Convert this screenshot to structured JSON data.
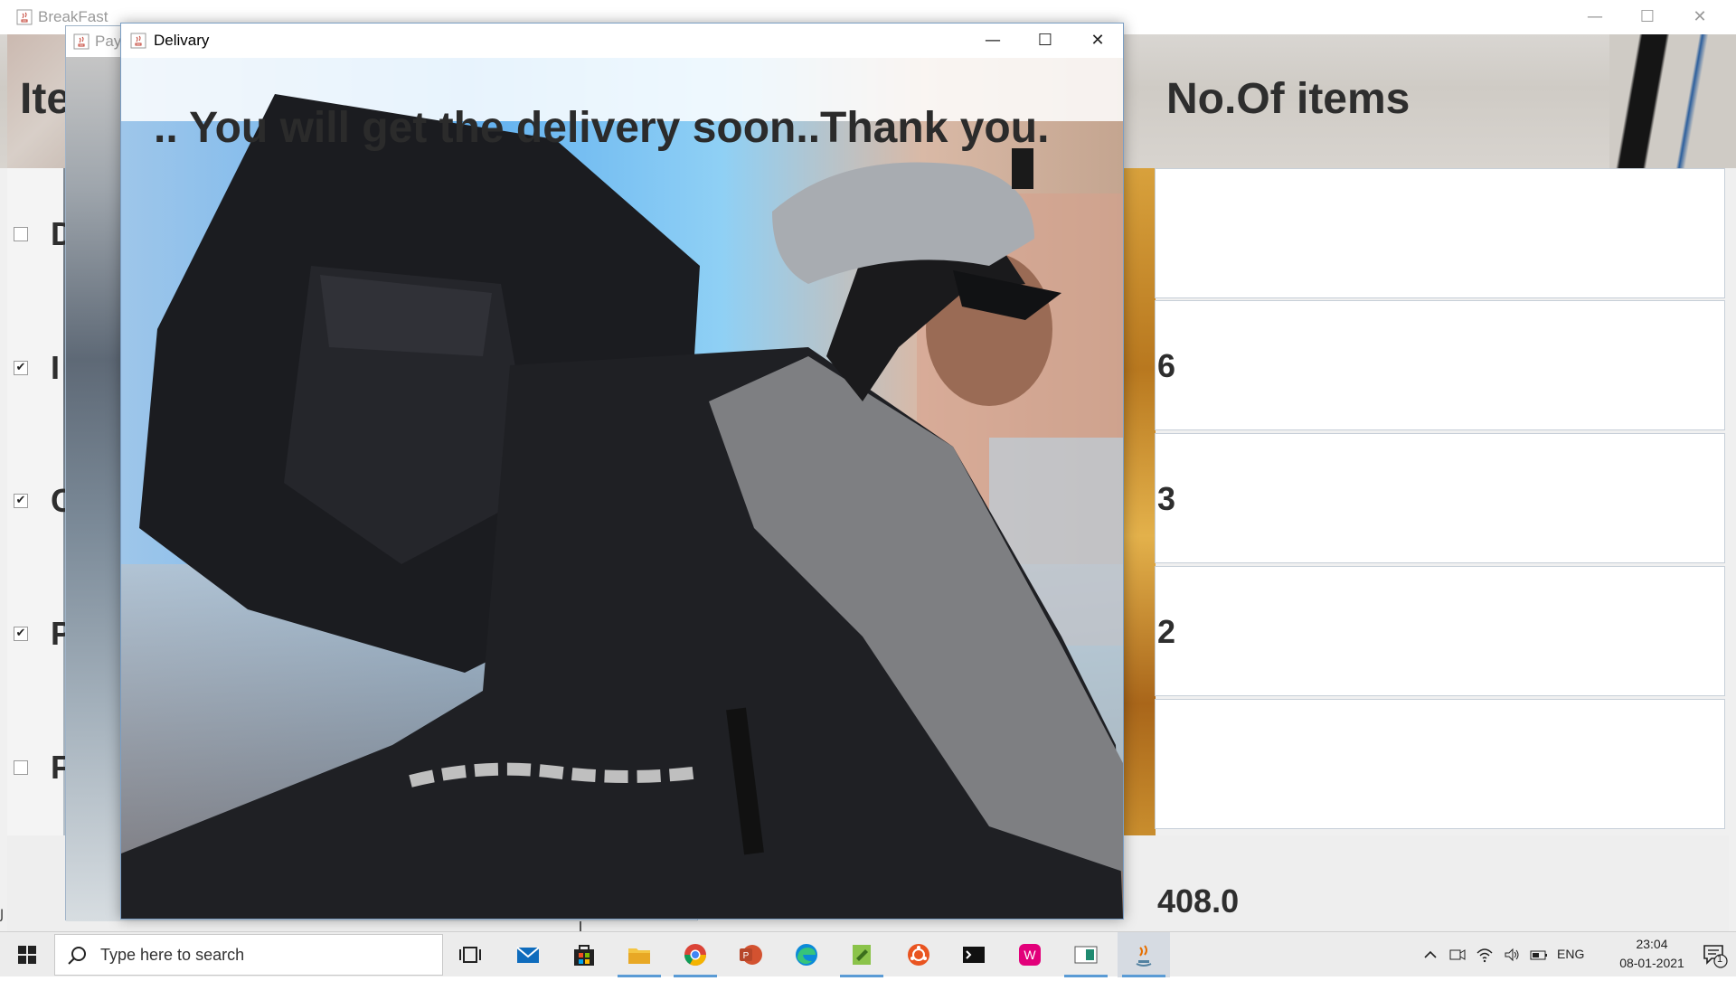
{
  "breakfast_window": {
    "title": "BreakFast",
    "items_heading": "Ite",
    "no_of_items_heading": "No.Of items",
    "items": [
      {
        "label": "D",
        "checked": false
      },
      {
        "label": "I",
        "checked": true
      },
      {
        "label": "C",
        "checked": true
      },
      {
        "label": "P",
        "checked": true
      },
      {
        "label": "F",
        "checked": false
      }
    ],
    "quantities": [
      "",
      "6",
      "3",
      "2",
      ""
    ],
    "total": "408.0",
    "left_edge_text": "J"
  },
  "pay_window": {
    "title": "Pay"
  },
  "delivery_window": {
    "title": "Delivary",
    "message": ".. You will get the delivery soon..Thank you."
  },
  "taskbar": {
    "search_placeholder": "Type here to search",
    "apps": [
      "task-view-icon",
      "mail-icon",
      "store-icon",
      "file-explorer-icon",
      "chrome-icon",
      "powerpoint-icon",
      "edge-icon",
      "notepad-plus-icon",
      "ubuntu-icon",
      "terminal-icon",
      "wampserver-icon",
      "app-icon",
      "java-icon"
    ],
    "language": "ENG",
    "time": "23:04",
    "date": "08-01-2021",
    "notification_count": "1"
  },
  "colors": {
    "taskbar_bg": "#ececec",
    "running_indicator": "#5a9bd5",
    "heading_text": "#2e2e2e"
  }
}
